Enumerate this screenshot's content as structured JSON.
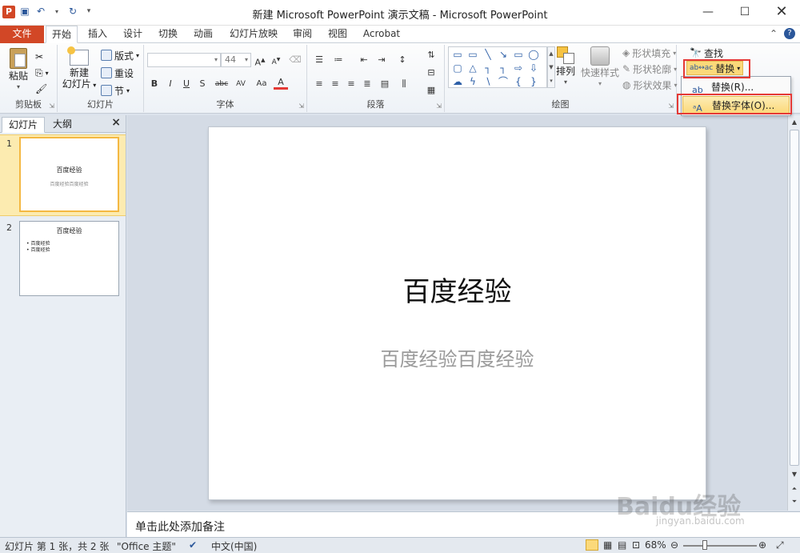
{
  "window": {
    "title": "新建 Microsoft PowerPoint 演示文稿 - Microsoft PowerPoint",
    "app_icon": "P",
    "controls": [
      "minimize-icon",
      "maximize-icon",
      "close-icon"
    ]
  },
  "tabs": [
    "文件",
    "开始",
    "插入",
    "设计",
    "切换",
    "动画",
    "幻灯片放映",
    "审阅",
    "视图",
    "Acrobat"
  ],
  "ribbon": {
    "clipboard": {
      "label": "剪贴板",
      "paste": "粘贴"
    },
    "slides": {
      "label": "幻灯片",
      "new_slide_1": "新建",
      "new_slide_2": "幻灯片",
      "layout": "版式",
      "reset": "重设",
      "section": "节"
    },
    "font": {
      "label": "字体",
      "size": "44",
      "buttons": [
        "B",
        "I",
        "U",
        "S",
        "abc",
        "AV",
        "Aa",
        "A"
      ]
    },
    "paragraph": {
      "label": "段落"
    },
    "drawing": {
      "label": "绘图",
      "arrange": "排列",
      "quick_styles": "快速样式",
      "shape_fill": "形状填充",
      "shape_outline": "形状轮廓",
      "shape_effects": "形状效果"
    },
    "editing": {
      "find": "查找",
      "replace": "替换"
    }
  },
  "replace_menu": {
    "items": [
      "替换(R)...",
      "替换字体(O)..."
    ],
    "highlighted": "替换字体(O)..."
  },
  "left_pane": {
    "tabs": [
      "幻灯片",
      "大纲"
    ],
    "close": "×",
    "slides": [
      {
        "num": "1",
        "title": "百度经验",
        "subtitle": "百度经验百度经验"
      },
      {
        "num": "2",
        "title": "百度经验",
        "bullets": [
          "• 百度经验",
          "• 百度经验"
        ]
      }
    ]
  },
  "slide": {
    "title": "百度经验",
    "subtitle": "百度经验百度经验"
  },
  "notes": {
    "placeholder": "单击此处添加备注"
  },
  "status": {
    "slide_info": "幻灯片 第 1 张，共 2 张",
    "theme": "\"Office 主题\"",
    "language": "中文(中国)",
    "zoom": "68%"
  },
  "watermark": {
    "text": "Baidu经验",
    "url": "jingyan.baidu.com"
  },
  "colors": {
    "file_tab": "#d24726",
    "accent": "#2b579a",
    "highlight": "#fbd97a",
    "annotation": "#e53935"
  }
}
